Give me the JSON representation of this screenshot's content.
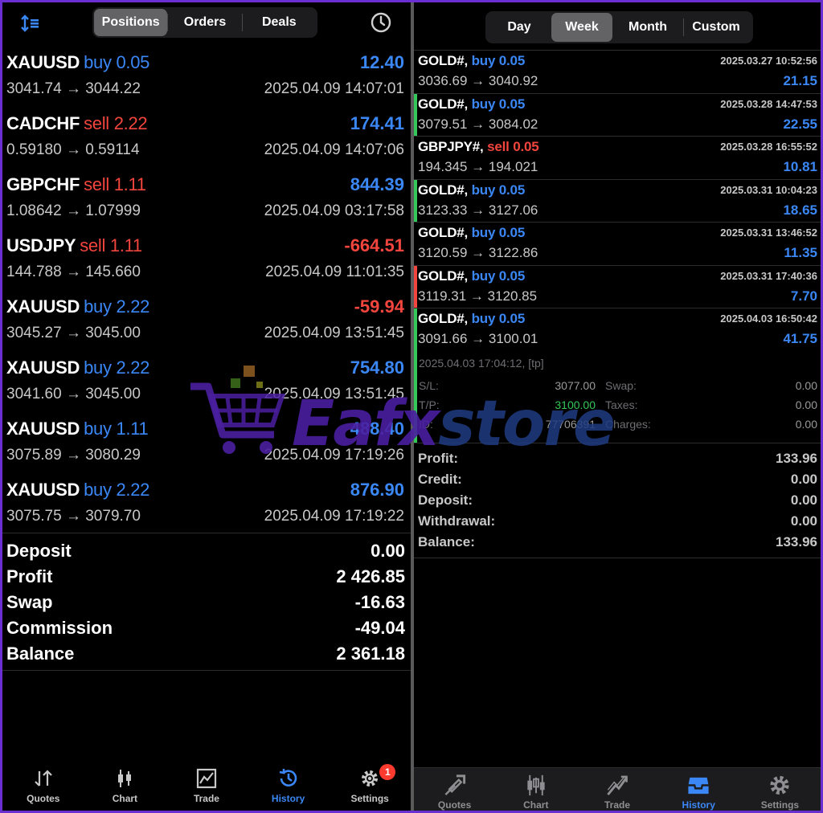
{
  "left": {
    "tabs": [
      "Positions",
      "Orders",
      "Deals"
    ],
    "active_tab": "Positions",
    "positions": [
      {
        "symbol": "XAUUSD",
        "type": "buy",
        "volume": "0.05",
        "profit": "12.40",
        "profit_color": "#3a87f5",
        "prices": "3041.74 → 3044.22",
        "time": "2025.04.09 14:07:01"
      },
      {
        "symbol": "CADCHF",
        "type": "sell",
        "volume": "2.22",
        "profit": "174.41",
        "profit_color": "#3a87f5",
        "prices": "0.59180 → 0.59114",
        "time": "2025.04.09 14:07:06"
      },
      {
        "symbol": "GBPCHF",
        "type": "sell",
        "volume": "1.11",
        "profit": "844.39",
        "profit_color": "#3a87f5",
        "prices": "1.08642 → 1.07999",
        "time": "2025.04.09 03:17:58"
      },
      {
        "symbol": "USDJPY",
        "type": "sell",
        "volume": "1.11",
        "profit": "-664.51",
        "profit_color": "#f2453d",
        "prices": "144.788 → 145.660",
        "time": "2025.04.09 11:01:35"
      },
      {
        "symbol": "XAUUSD",
        "type": "buy",
        "volume": "2.22",
        "profit": "-59.94",
        "profit_color": "#f2453d",
        "prices": "3045.27 → 3045.00",
        "time": "2025.04.09 13:51:45"
      },
      {
        "symbol": "XAUUSD",
        "type": "buy",
        "volume": "2.22",
        "profit": "754.80",
        "profit_color": "#3a87f5",
        "prices": "3041.60 → 3045.00",
        "time": "2025.04.09 13:51:45"
      },
      {
        "symbol": "XAUUSD",
        "type": "buy",
        "volume": "1.11",
        "profit": "488.40",
        "profit_color": "#3a87f5",
        "prices": "3075.89 → 3080.29",
        "time": "2025.04.09 17:19:26"
      },
      {
        "symbol": "XAUUSD",
        "type": "buy",
        "volume": "2.22",
        "profit": "876.90",
        "profit_color": "#3a87f5",
        "prices": "3075.75 → 3079.70",
        "time": "2025.04.09 17:19:22"
      }
    ],
    "summary": [
      {
        "label": "Deposit",
        "value": "0.00"
      },
      {
        "label": "Profit",
        "value": "2 426.85"
      },
      {
        "label": "Swap",
        "value": "-16.63"
      },
      {
        "label": "Commission",
        "value": "-49.04"
      },
      {
        "label": "Balance",
        "value": "2 361.18"
      }
    ],
    "tabbar": [
      {
        "label": "Quotes",
        "icon": "quotes-icon"
      },
      {
        "label": "Chart",
        "icon": "chart-icon"
      },
      {
        "label": "Trade",
        "icon": "trade-icon"
      },
      {
        "label": "History",
        "icon": "history-icon",
        "active": true
      },
      {
        "label": "Settings",
        "icon": "settings-icon",
        "badge": "1"
      }
    ]
  },
  "right": {
    "periods": [
      "Day",
      "Week",
      "Month",
      "Custom"
    ],
    "active_period": "Week",
    "deals": [
      {
        "symbol": "GOLD#,",
        "type": "buy",
        "volume": "0.05",
        "time": "2025.03.27 10:52:56",
        "prices": "3036.69 → 3040.92",
        "profit": "21.15",
        "mark": ""
      },
      {
        "symbol": "GOLD#,",
        "type": "buy",
        "volume": "0.05",
        "time": "2025.03.28 14:47:53",
        "prices": "3079.51 → 3084.02",
        "profit": "22.55",
        "mark": "#34c759"
      },
      {
        "symbol": "GBPJPY#,",
        "type": "sell",
        "volume": "0.05",
        "time": "2025.03.28 16:55:52",
        "prices": "194.345 → 194.021",
        "profit": "10.81",
        "mark": ""
      },
      {
        "symbol": "GOLD#,",
        "type": "buy",
        "volume": "0.05",
        "time": "2025.03.31 10:04:23",
        "prices": "3123.33 → 3127.06",
        "profit": "18.65",
        "mark": "#34c759"
      },
      {
        "symbol": "GOLD#,",
        "type": "buy",
        "volume": "0.05",
        "time": "2025.03.31 13:46:52",
        "prices": "3120.59 → 3122.86",
        "profit": "11.35",
        "mark": ""
      },
      {
        "symbol": "GOLD#,",
        "type": "buy",
        "volume": "0.05",
        "time": "2025.03.31 17:40:36",
        "prices": "3119.31 → 3120.85",
        "profit": "7.70",
        "mark": "#f2453d"
      },
      {
        "symbol": "GOLD#,",
        "type": "buy",
        "volume": "0.05",
        "time": "2025.04.03 16:50:42",
        "prices": "3091.66 → 3100.01",
        "profit": "41.75",
        "mark": "#34c759"
      }
    ],
    "detail": {
      "close_time": "2025.04.03 17:04:12, [tp]",
      "sl_label": "S/L:",
      "sl": "3077.00",
      "tp_label": "T/P:",
      "tp": "3100.00",
      "id_label": "ID:",
      "id": "77706391",
      "swap_label": "Swap:",
      "swap": "0.00",
      "taxes_label": "Taxes:",
      "taxes": "0.00",
      "charges_label": "Charges:",
      "charges": "0.00"
    },
    "summary": [
      {
        "label": "Profit:",
        "value": "133.96"
      },
      {
        "label": "Credit:",
        "value": "0.00"
      },
      {
        "label": "Deposit:",
        "value": "0.00"
      },
      {
        "label": "Withdrawal:",
        "value": "0.00"
      },
      {
        "label": "Balance:",
        "value": "133.96"
      }
    ],
    "tabbar": [
      {
        "label": "Quotes",
        "icon": "quotes-icon"
      },
      {
        "label": "Chart",
        "icon": "chart-icon"
      },
      {
        "label": "Trade",
        "icon": "trade-icon"
      },
      {
        "label": "History",
        "icon": "history-icon",
        "active": true
      },
      {
        "label": "Settings",
        "icon": "settings-icon"
      }
    ]
  },
  "watermark": {
    "part1": "Eafx",
    "part2": "store"
  },
  "colors": {
    "buy": "#3a87f5",
    "sell": "#f2453d",
    "accent": "#3a87f5",
    "border": "#6a2fd0"
  }
}
